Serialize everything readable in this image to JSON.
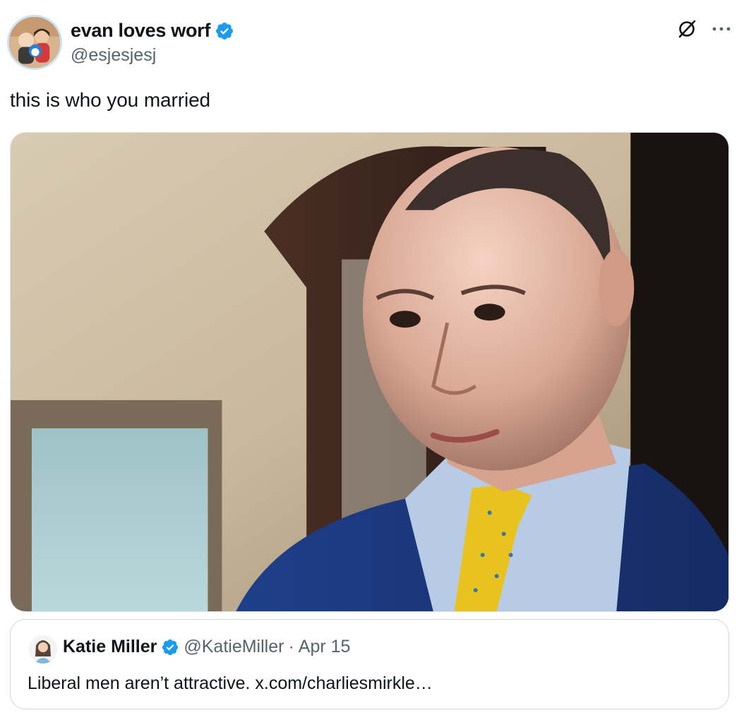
{
  "tweet": {
    "author": {
      "display_name": "evan loves worf",
      "handle": "@esjesjesj",
      "verified": true
    },
    "text": "this is who you married",
    "icons": {
      "grok": "grok-icon",
      "more": "more-options-icon"
    },
    "media": {
      "description_icon": "photo"
    },
    "quote": {
      "author": {
        "display_name": "Katie Miller",
        "handle": "@KatieMiller",
        "verified": true
      },
      "separator": "·",
      "date": "Apr 15",
      "text": "Liberal men aren’t attractive. x.com/charliesmirkle…"
    }
  },
  "colors": {
    "verified": "#1d9bf0",
    "text_primary": "#0f1419",
    "text_secondary": "#536471",
    "border": "#cfd9de"
  }
}
